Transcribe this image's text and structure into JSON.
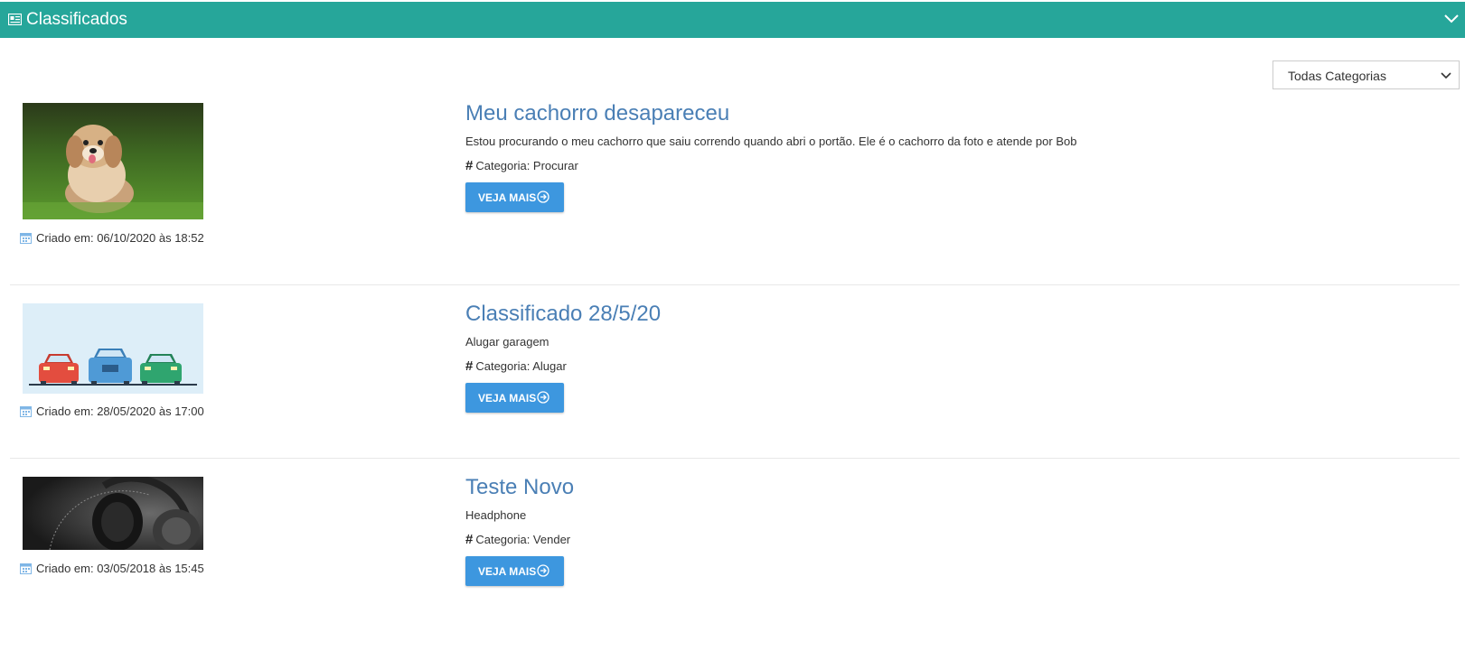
{
  "header": {
    "title": "Classificados",
    "icon": "newspaper-icon",
    "toggle_icon": "chevron-down-icon"
  },
  "filter": {
    "selected": "Todas Categorias"
  },
  "items": [
    {
      "title": "Meu cachorro desapareceu",
      "description": "Estou procurando o meu cachorro que saiu correndo quando abri o portão. Ele é o cachorro da foto e atende por Bob",
      "category": "Categoria: Procurar",
      "created": "Criado em: 06/10/2020 às 18:52",
      "button": "VEJA MAIS",
      "image": "dog-photo"
    },
    {
      "title": "Classificado 28/5/20",
      "description": "Alugar garagem",
      "category": "Categoria: Alugar",
      "created": "Criado em: 28/05/2020 às 17:00",
      "button": "VEJA MAIS",
      "image": "cars-illustration"
    },
    {
      "title": "Teste Novo",
      "description": "Headphone",
      "category": "Categoria: Vender",
      "created": "Criado em: 03/05/2018 às 15:45",
      "button": "VEJA MAIS",
      "image": "headphone-photo"
    }
  ],
  "colors": {
    "header": "#26a69a",
    "title": "#4a7fb5",
    "button": "#3d97df",
    "calendar_icon": "#7fb6e6"
  }
}
